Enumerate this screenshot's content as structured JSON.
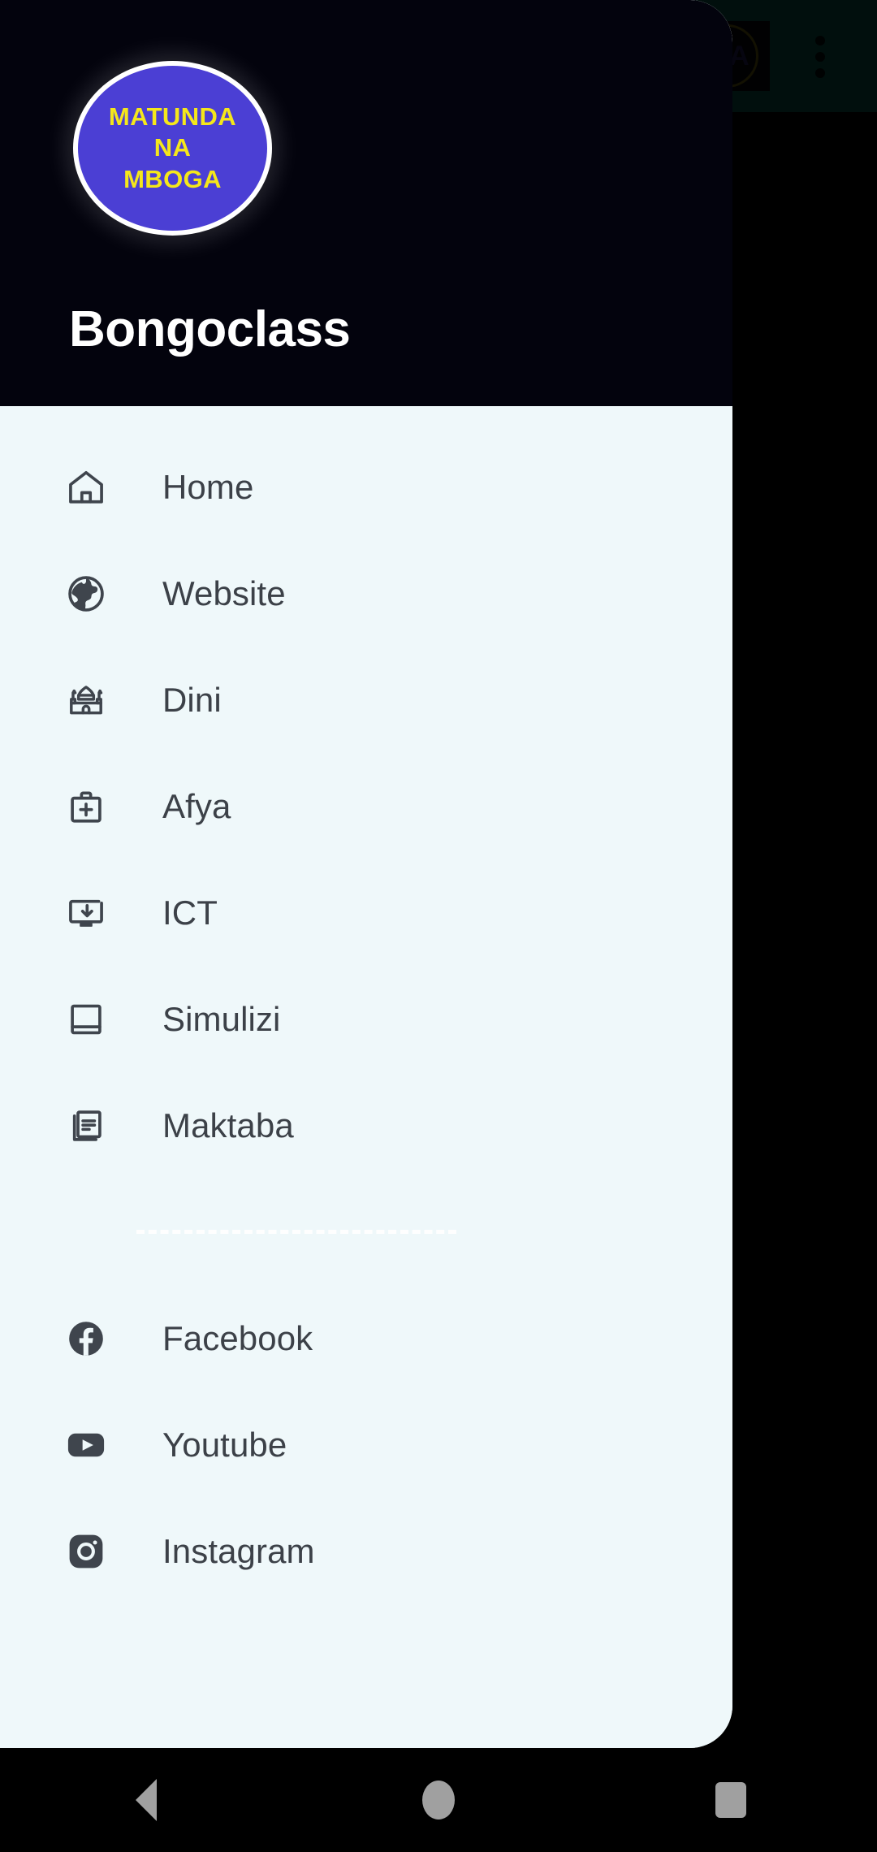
{
  "app": {
    "accent_teal": "#08695B",
    "drawer_bg": "#EFF8FA",
    "drawer_header_bg": "#03030D",
    "text_color": "#3C4148"
  },
  "appbar": {
    "logo_text": "ZA",
    "overflow_label": "More options"
  },
  "drawer": {
    "brand_name": "Bongoclass",
    "logo": {
      "line1": "MATUNDA",
      "line2": "NA",
      "line3": "MBOGA",
      "circle_color": "#4B3FD4",
      "text_color": "#F5E71B",
      "border_color": "#FFFFFF"
    },
    "primary_items": [
      {
        "label": "Home",
        "icon": "home-icon"
      },
      {
        "label": "Website",
        "icon": "globe-icon"
      },
      {
        "label": "Dini",
        "icon": "mosque-icon"
      },
      {
        "label": "Afya",
        "icon": "medical-bag-icon"
      },
      {
        "label": "ICT",
        "icon": "monitor-download-icon"
      },
      {
        "label": "Simulizi",
        "icon": "book-icon"
      },
      {
        "label": "Maktaba",
        "icon": "library-icon"
      }
    ],
    "social_items": [
      {
        "label": "Facebook",
        "icon": "facebook-icon"
      },
      {
        "label": "Youtube",
        "icon": "youtube-icon"
      },
      {
        "label": "Instagram",
        "icon": "instagram-icon"
      }
    ]
  },
  "navbar": {
    "back_label": "Back",
    "home_label": "Home",
    "recents_label": "Recents"
  }
}
